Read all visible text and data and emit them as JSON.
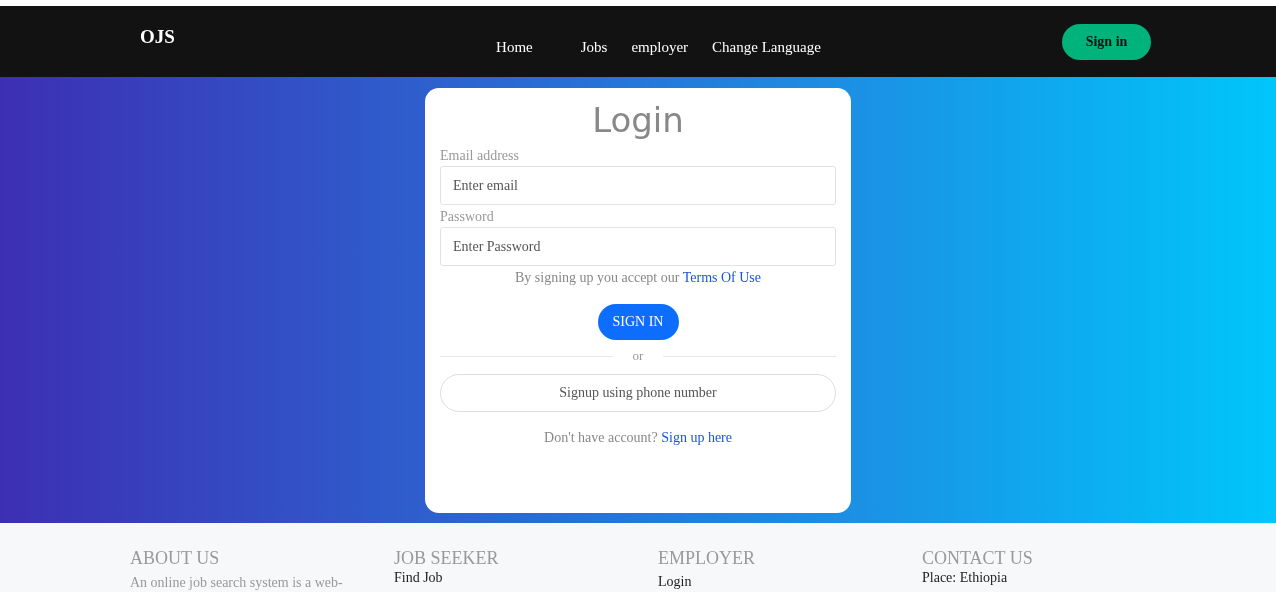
{
  "navbar": {
    "logo": "OJS",
    "links": [
      "Home",
      "Jobs",
      "employer",
      "Change Language"
    ],
    "sign_in": "Sign in"
  },
  "login": {
    "title": "Login",
    "fields": [
      {
        "label": "Email address",
        "placeholder": "Enter email"
      },
      {
        "label": "Password",
        "placeholder": "Enter Password"
      }
    ],
    "terms": {
      "text": "By signing up you accept our",
      "link": "Terms Of Use"
    },
    "submit": "SIGN IN",
    "divider": "or",
    "phone_button": "Signup using phone number",
    "signup": {
      "text": "Don't have account?",
      "link": "Sign up here"
    }
  },
  "footer": {
    "columns": [
      {
        "heading": "ABOUT US",
        "kind": "text",
        "items": [
          "An online job search system is a web-"
        ]
      },
      {
        "heading": "JOB SEEKER",
        "kind": "links",
        "items": [
          "Find Job"
        ]
      },
      {
        "heading": "EMPLOYER",
        "kind": "links",
        "items": [
          "Login"
        ]
      },
      {
        "heading": "CONTACT US",
        "kind": "links",
        "items": [
          "Place: Ethiopia"
        ]
      }
    ]
  }
}
